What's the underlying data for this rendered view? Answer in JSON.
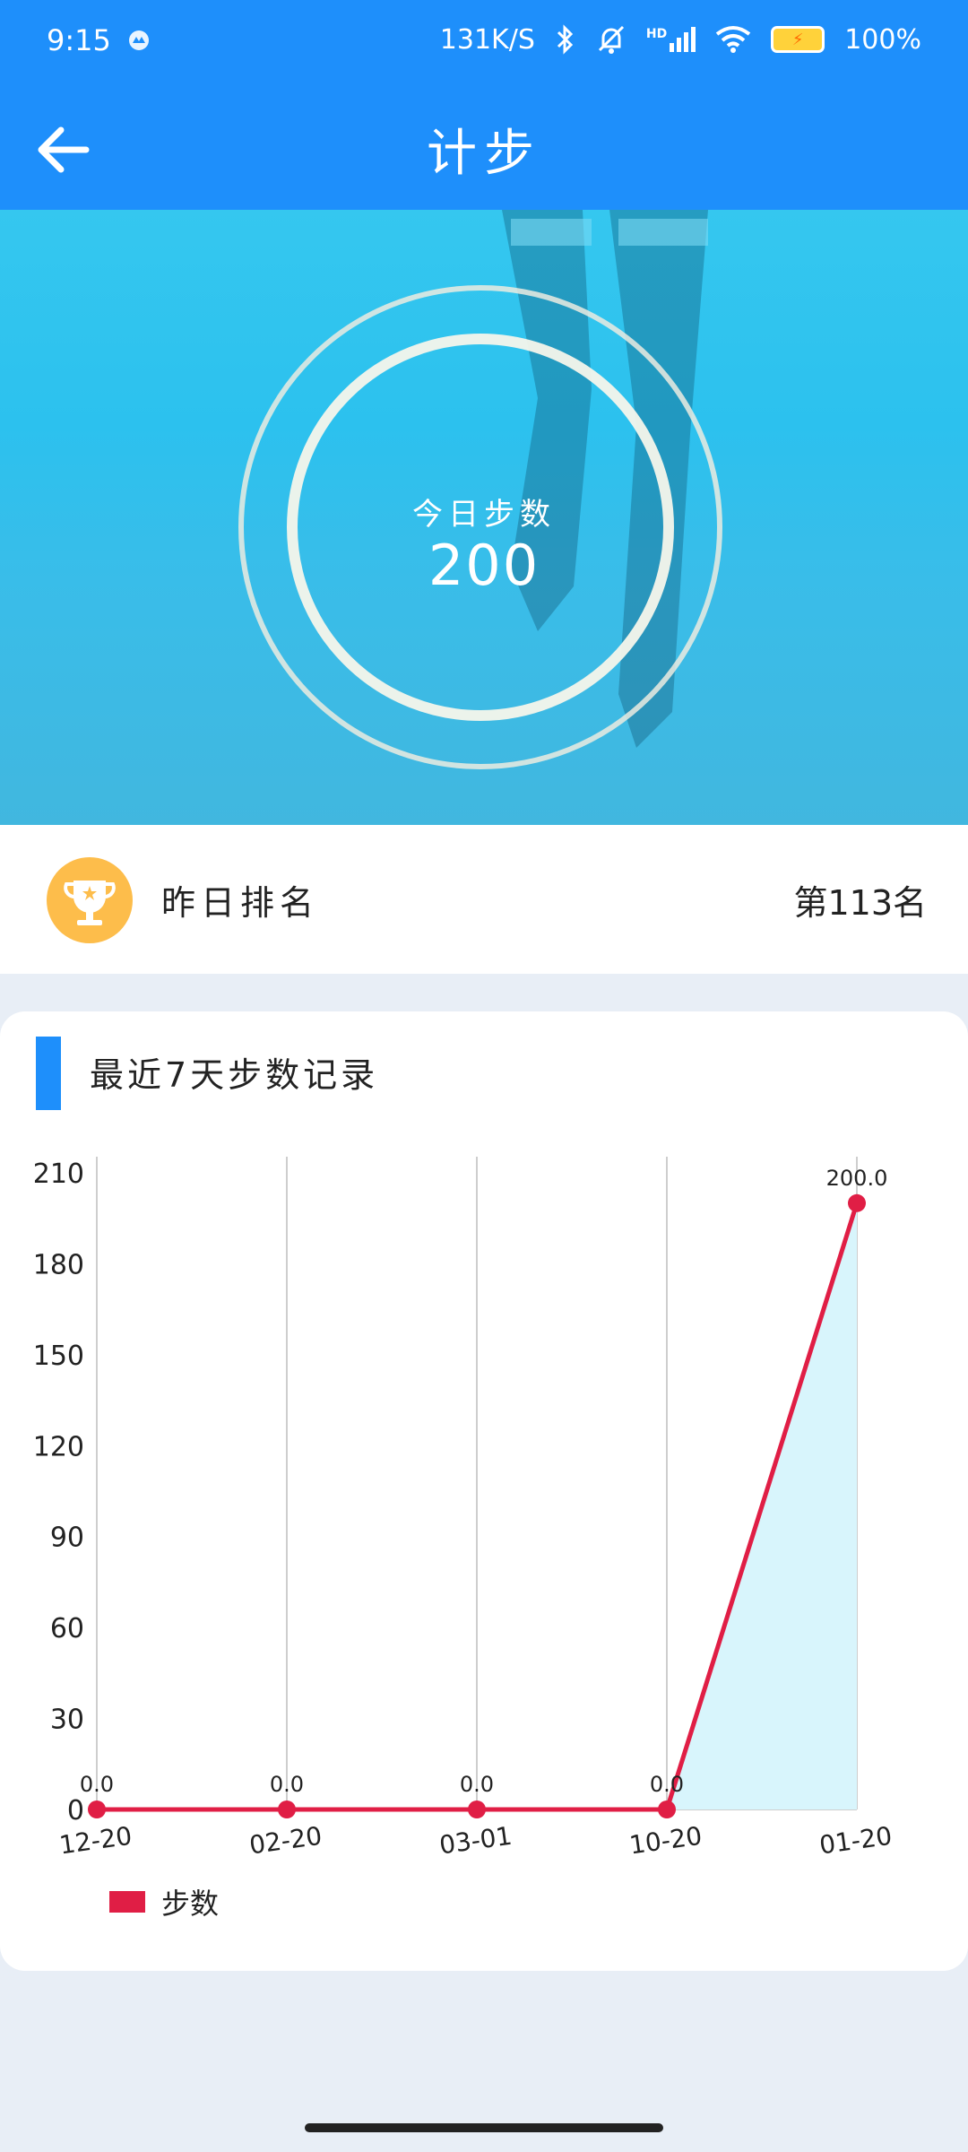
{
  "status_bar": {
    "time": "9:15",
    "network_speed": "131K/S",
    "signal_label": "HD",
    "battery": "100%"
  },
  "appbar": {
    "title": "计步"
  },
  "hero": {
    "today_label": "今日步数",
    "today_value": "200"
  },
  "ranking": {
    "label": "昨日排名",
    "value": "第113名"
  },
  "chart_card": {
    "title": "最近7天步数记录"
  },
  "chart_data": {
    "type": "line",
    "categories": [
      "12-20",
      "02-20",
      "03-01",
      "10-20",
      "01-20"
    ],
    "series": [
      {
        "name": "步数",
        "values": [
          0,
          0,
          0,
          0,
          200
        ],
        "color": "#e01e45"
      }
    ],
    "data_labels": [
      "0.0",
      "0.0",
      "0.0",
      "0.0",
      "200.0"
    ],
    "yticks": [
      0,
      30,
      60,
      90,
      120,
      150,
      180,
      210
    ],
    "ylim": [
      0,
      210
    ],
    "grid": "vertical",
    "fill_color": "#d8f5fc",
    "legend_position": "bottom-left"
  },
  "legend": {
    "label": "步数"
  }
}
